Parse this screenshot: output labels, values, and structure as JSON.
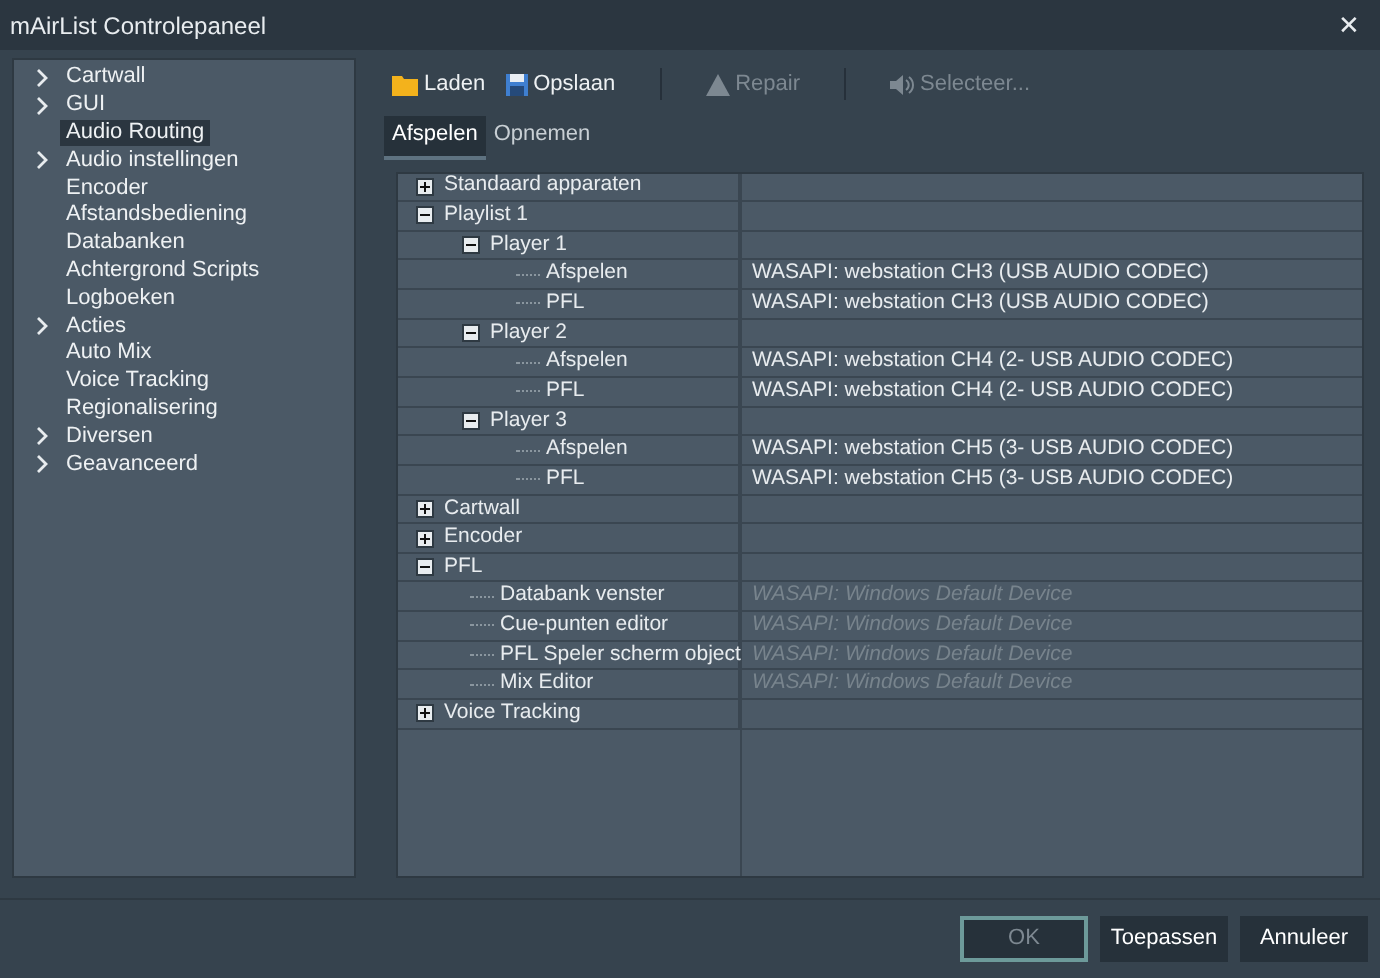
{
  "window": {
    "title": "mAirList Controlepaneel",
    "close": "✕"
  },
  "sidebar": {
    "items": [
      {
        "label": "Cartwall",
        "expandable": true,
        "selected": false
      },
      {
        "label": "GUI",
        "expandable": true,
        "selected": false
      },
      {
        "label": "Audio Routing",
        "expandable": false,
        "selected": true
      },
      {
        "label": "Audio instellingen",
        "expandable": true,
        "selected": false
      },
      {
        "label": "Encoder",
        "expandable": false,
        "selected": false
      },
      {
        "label": "Afstandsbediening",
        "expandable": false,
        "selected": false
      },
      {
        "label": "Databanken",
        "expandable": false,
        "selected": false
      },
      {
        "label": "Achtergrond Scripts",
        "expandable": false,
        "selected": false
      },
      {
        "label": "Logboeken",
        "expandable": false,
        "selected": false
      },
      {
        "label": "Acties",
        "expandable": true,
        "selected": false
      },
      {
        "label": "Auto Mix",
        "expandable": false,
        "selected": false
      },
      {
        "label": "Voice Tracking",
        "expandable": false,
        "selected": false
      },
      {
        "label": "Regionalisering",
        "expandable": false,
        "selected": false
      },
      {
        "label": "Diversen",
        "expandable": true,
        "selected": false
      },
      {
        "label": "Geavanceerd",
        "expandable": true,
        "selected": false
      }
    ]
  },
  "toolbar": [
    {
      "label": "Laden",
      "kind": "folder",
      "disabled": false
    },
    {
      "label": "Opslaan",
      "kind": "save",
      "disabled": false
    },
    {
      "label": "Repair",
      "kind": "warning",
      "disabled": true
    },
    {
      "label": "Selecteer...",
      "kind": "speaker",
      "disabled": true
    }
  ],
  "tabs": [
    {
      "label": "Afspelen",
      "selected": true
    },
    {
      "label": "Opnemen",
      "selected": false
    }
  ],
  "tree": [
    {
      "label": "Standaard apparaten",
      "expanded": false
    },
    {
      "label": "Playlist 1",
      "expanded": true,
      "children": [
        {
          "label": "Player 1",
          "expanded": true,
          "children": [
            {
              "label": "Afspelen",
              "value": "WASAPI: webstation CH3 (USB AUDIO  CODEC)",
              "default": false
            },
            {
              "label": "PFL",
              "value": "WASAPI: webstation CH3 (USB AUDIO  CODEC)",
              "default": false
            }
          ]
        },
        {
          "label": "Player 2",
          "expanded": true,
          "children": [
            {
              "label": "Afspelen",
              "value": "WASAPI: webstation CH4 (2- USB AUDIO  CODEC)",
              "default": false
            },
            {
              "label": "PFL",
              "value": "WASAPI: webstation CH4 (2- USB AUDIO  CODEC)",
              "default": false
            }
          ]
        },
        {
          "label": "Player 3",
          "expanded": true,
          "children": [
            {
              "label": "Afspelen",
              "value": "WASAPI: webstation CH5 (3- USB AUDIO  CODEC)",
              "default": false
            },
            {
              "label": "PFL",
              "value": "WASAPI: webstation CH5 (3- USB AUDIO  CODEC)",
              "default": false
            }
          ]
        }
      ]
    },
    {
      "label": "Cartwall",
      "expanded": false
    },
    {
      "label": "Encoder",
      "expanded": false
    },
    {
      "label": "PFL",
      "expanded": true,
      "children": [
        {
          "label": "Databank venster",
          "value": "WASAPI: Windows Default Device",
          "default": true
        },
        {
          "label": "Cue-punten editor",
          "value": "WASAPI: Windows Default Device",
          "default": true
        },
        {
          "label": "PFL Speler scherm object",
          "value": "WASAPI: Windows Default Device",
          "default": true
        },
        {
          "label": "Mix Editor",
          "value": "WASAPI: Windows Default Device",
          "default": true
        }
      ]
    },
    {
      "label": "Voice Tracking",
      "expanded": false
    }
  ],
  "buttons": [
    {
      "label": "OK",
      "focused": true,
      "disabled": true
    },
    {
      "label": "Toepassen",
      "focused": false,
      "disabled": false
    },
    {
      "label": "Annuleer",
      "focused": false,
      "disabled": false
    }
  ]
}
